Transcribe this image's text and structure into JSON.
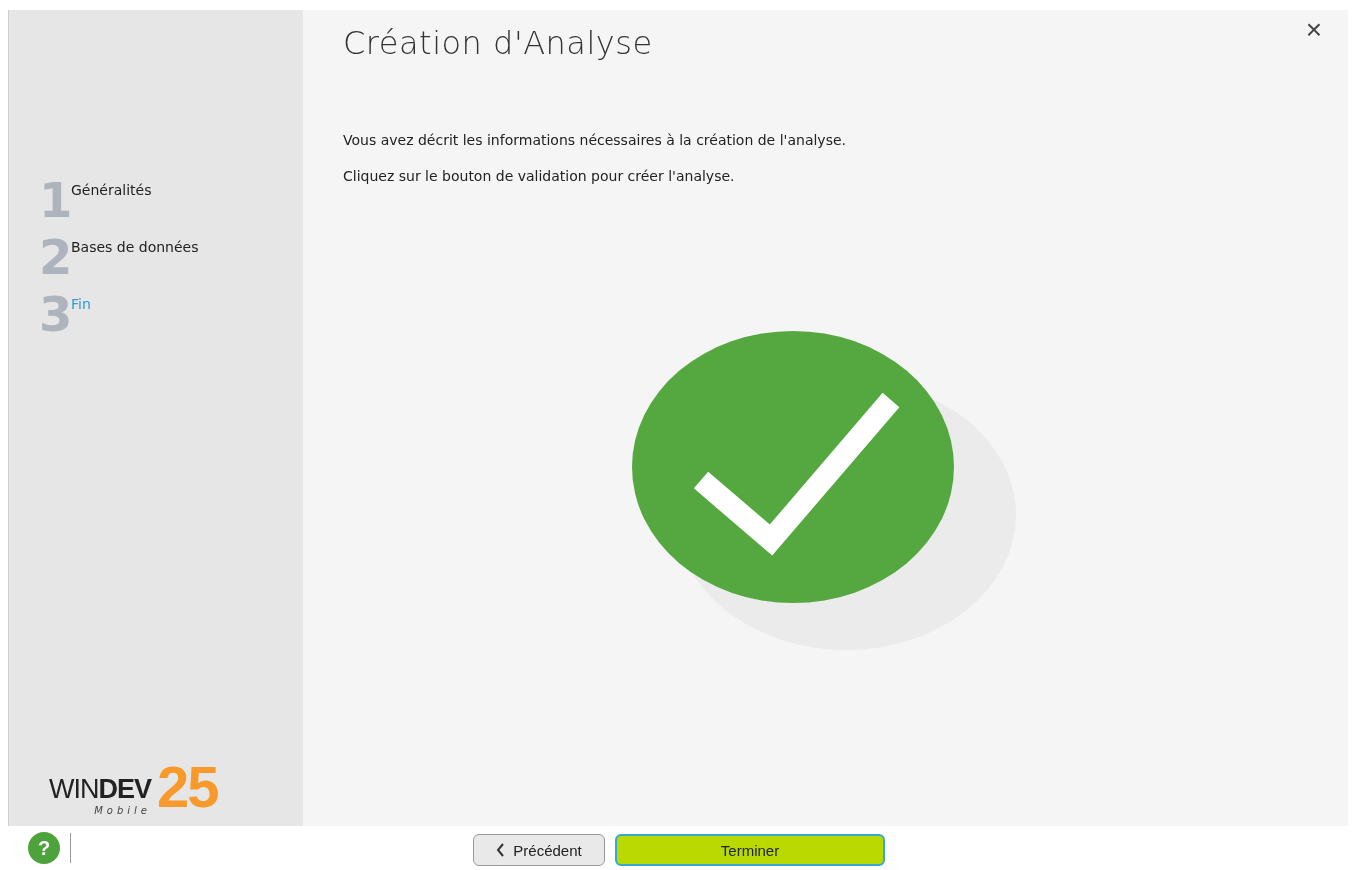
{
  "title": "Création d'Analyse",
  "paragraphs": [
    "Vous avez décrit les informations nécessaires à la création de l'analyse.",
    "Cliquez sur le bouton de validation pour créer l'analyse."
  ],
  "steps": [
    {
      "number": "1",
      "label": "Généralités",
      "selected": false
    },
    {
      "number": "2",
      "label": "Bases de données",
      "selected": false
    },
    {
      "number": "3",
      "label": "Fin",
      "selected": true
    }
  ],
  "logo": {
    "light": "WIN",
    "bold": "DEV",
    "version": "25",
    "edition": "Mobile"
  },
  "close": "×",
  "help": "?",
  "buttons": [
    {
      "kind": "back",
      "label": "Précédent"
    },
    {
      "kind": "primary",
      "label": "Terminer"
    }
  ]
}
